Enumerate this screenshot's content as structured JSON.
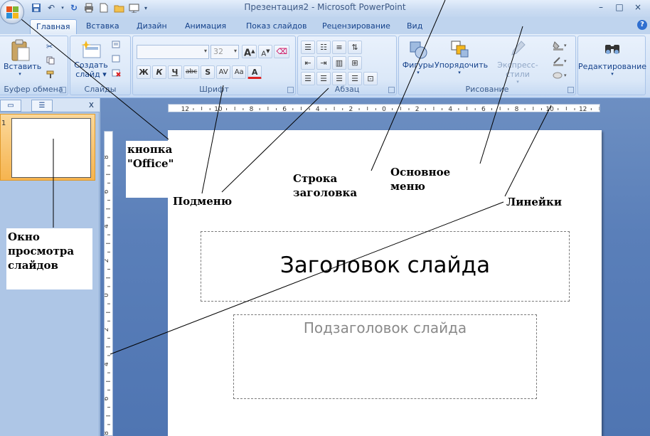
{
  "window": {
    "title": "Презентация2 - Microsoft PowerPoint",
    "controls": [
      "–",
      "□",
      "×"
    ]
  },
  "tabs": [
    "Главная",
    "Вставка",
    "Дизайн",
    "Анимация",
    "Показ слайдов",
    "Рецензирование",
    "Вид"
  ],
  "ribbon": {
    "clipboard": {
      "paste": "Вставить",
      "label": "Буфер обмена"
    },
    "slides": {
      "new_slide_line1": "Создать",
      "new_slide_line2": "слайд",
      "label": "Слайды"
    },
    "font": {
      "font_name": "",
      "font_size": "32",
      "bold": "Ж",
      "italic": "К",
      "underline": "Ч",
      "strike": "abc",
      "shadow": "S",
      "spacing": "AV",
      "case": "Aa",
      "color": "A",
      "grow": "A",
      "shrink": "A",
      "label": "Шрифт"
    },
    "paragraph": {
      "label": "Абзац"
    },
    "drawing": {
      "shapes": "Фигуры",
      "arrange": "Упорядочить",
      "quick_styles": "Экспресс-стили",
      "label": "Рисование"
    },
    "editing": {
      "label": "Редактирование"
    }
  },
  "ruler": {
    "horizontal_ticks": [
      "12",
      "10",
      "8",
      "6",
      "4",
      "2",
      "0",
      "2",
      "4",
      "6",
      "8",
      "10",
      "12"
    ],
    "vertical_ticks": [
      "8",
      "6",
      "4",
      "2",
      "0",
      "2",
      "4",
      "6",
      "8"
    ]
  },
  "slide_pane": {
    "slide_number": "1"
  },
  "slide": {
    "title_placeholder": "Заголовок слайда",
    "subtitle_placeholder": "Подзаголовок слайда"
  },
  "annotations": {
    "office_button_line1": "кнопка",
    "office_button_line2": "\"Office\"",
    "submenu": "Подменю",
    "title_bar_line1": "Строка",
    "title_bar_line2": "заголовка",
    "main_menu_line1": "Основное",
    "main_menu_line2": "меню",
    "rulers": "Линейки",
    "slide_pane_line1": "Окно",
    "slide_pane_line2": "просмотра",
    "slide_pane_line3": "слайдов"
  },
  "colors": {
    "office_logo": [
      "#e8541c",
      "#7fb735",
      "#2b8fd8",
      "#f5b81d"
    ],
    "accent_tab_border": "#8db2e3"
  }
}
